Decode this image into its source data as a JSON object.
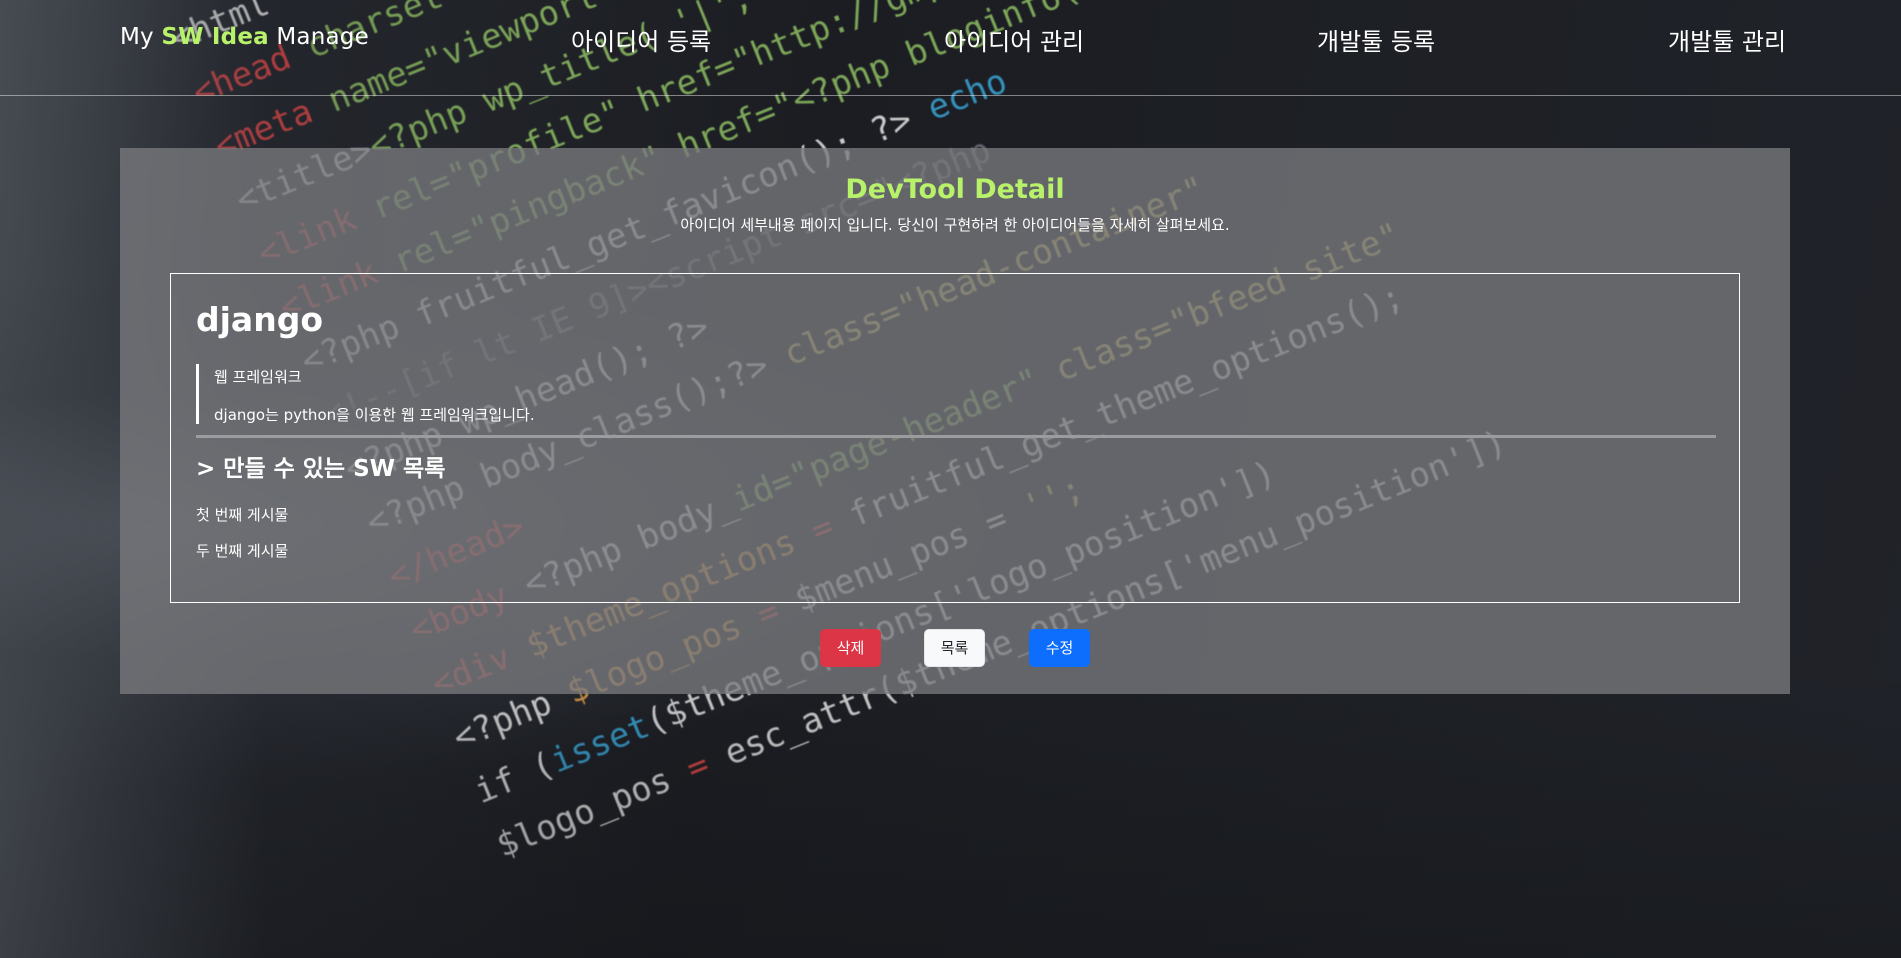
{
  "navbar": {
    "brand_prefix": "My ",
    "brand_accent": "SW Idea",
    "brand_suffix": " Manage",
    "links": [
      {
        "label": "아이디어 등록"
      },
      {
        "label": "아이디어 관리"
      },
      {
        "label": "개발툴 등록"
      },
      {
        "label": "개발툴 관리"
      }
    ]
  },
  "page": {
    "title": "DevTool Detail",
    "subtitle": "아이디어 세부내용 페이지 입니다. 당신이 구현하려 한 아이디어들을 자세히 살펴보세요."
  },
  "tool": {
    "name": "django",
    "category": "웹 프레임워크",
    "description": "django는 python을 이용한 웹 프레임워크입니다."
  },
  "sw_section": {
    "heading": "> 만들 수 있는 SW 목록",
    "items": [
      "첫 번째 게시물",
      "두 번째 게시물"
    ]
  },
  "actions": {
    "delete_label": "삭제",
    "list_label": "목록",
    "edit_label": "수정"
  },
  "colors": {
    "accent": "#b7f26a",
    "danger": "#dc3545",
    "primary": "#0d6efd",
    "light": "#f8f9fa"
  }
}
